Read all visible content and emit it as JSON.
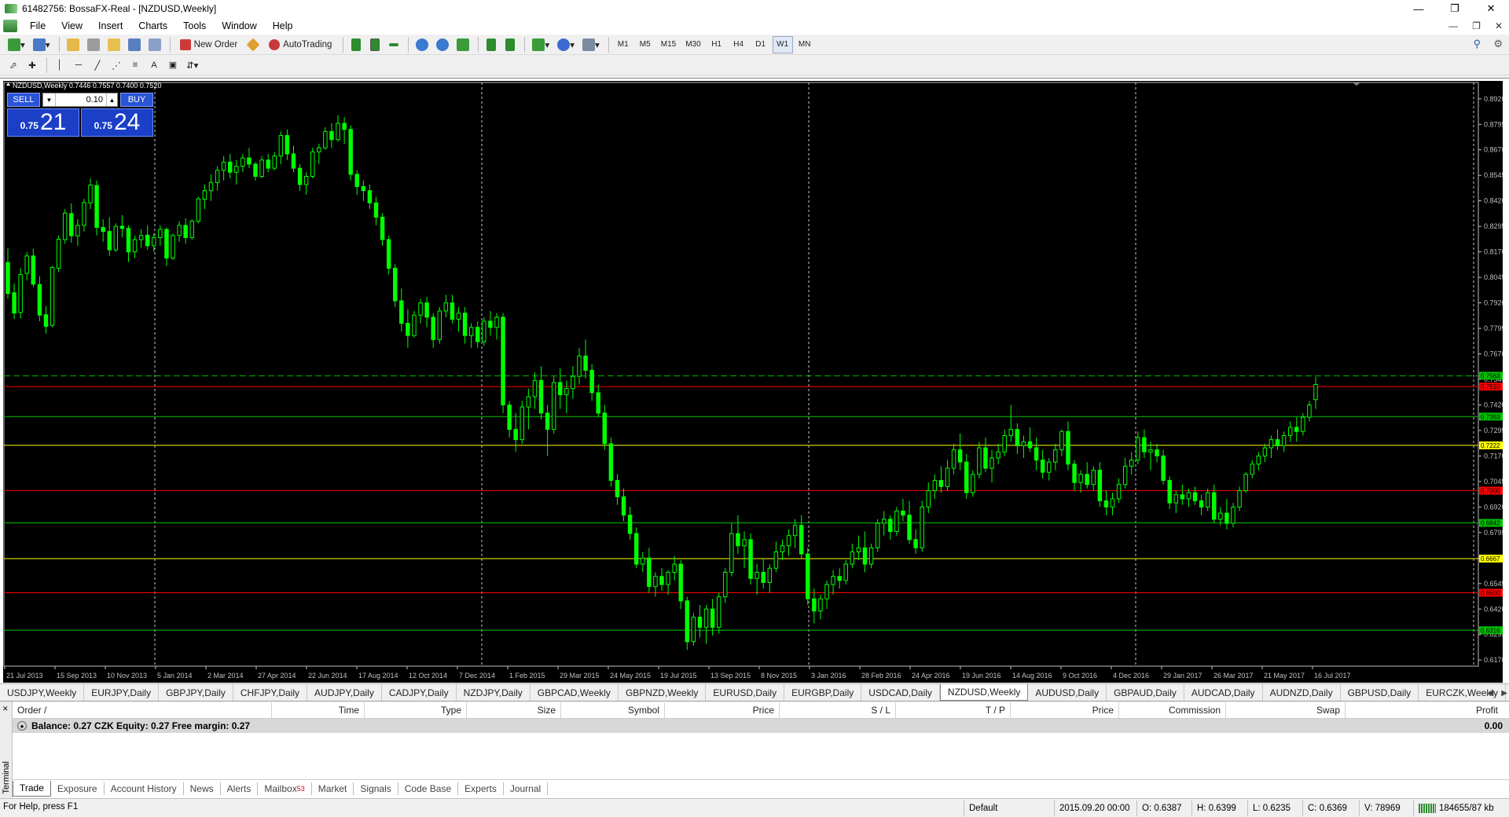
{
  "window": {
    "title": "61482756: BossaFX-Real - [NZDUSD,Weekly]"
  },
  "menu": [
    "File",
    "View",
    "Insert",
    "Charts",
    "Tools",
    "Window",
    "Help"
  ],
  "toolbar": {
    "new_order": "New Order",
    "autotrading": "AutoTrading",
    "timeframes": [
      "M1",
      "M5",
      "M15",
      "M30",
      "H1",
      "H4",
      "D1",
      "W1",
      "MN"
    ],
    "active_timeframe": "W1"
  },
  "chart": {
    "header": "NZDUSD,Weekly  0.7446 0.7557 0.7400 0.7520",
    "bg_color": "#000000",
    "bull_color": "#00ff00",
    "price_axis": [
      "0.8920",
      "0.8795",
      "0.8670",
      "0.8545",
      "0.8420",
      "0.8295",
      "0.8170",
      "0.8045",
      "0.7920",
      "0.7795",
      "0.7670",
      "0.7545",
      "0.7420",
      "0.7295",
      "0.7170",
      "0.7045",
      "0.6920",
      "0.6795",
      "0.6670",
      "0.6545",
      "0.6420",
      "0.6295",
      "0.6170"
    ],
    "time_axis": [
      "21 Jul 2013",
      "15 Sep 2013",
      "10 Nov 2013",
      "5 Jan 2014",
      "2 Mar 2014",
      "27 Apr 2014",
      "22 Jun 2014",
      "17 Aug 2014",
      "12 Oct 2014",
      "7 Dec 2014",
      "1 Feb 2015",
      "29 Mar 2015",
      "24 May 2015",
      "19 Jul 2015",
      "13 Sep 2015",
      "8 Nov 2015",
      "3 Jan 2016",
      "28 Feb 2016",
      "24 Apr 2016",
      "19 Jun 2016",
      "14 Aug 2016",
      "9 Oct 2016",
      "4 Dec 2016",
      "29 Jan 2017",
      "26 Mar 2017",
      "21 May 2017",
      "16 Jul 2017"
    ],
    "levels": [
      {
        "price": 0.7563,
        "color": "#00c000",
        "dash": true,
        "label": "0.7563"
      },
      {
        "price": 0.751,
        "color": "#ff0000",
        "label": "0.7510"
      },
      {
        "price": 0.7363,
        "color": "#00c000",
        "label": "0.7363"
      },
      {
        "price": 0.7222,
        "color": "#ffff00",
        "label": "0.7222"
      },
      {
        "price": 0.7,
        "color": "#ff0000",
        "label": "0.7000"
      },
      {
        "price": 0.6842,
        "color": "#00c000",
        "label": "0.6842"
      },
      {
        "price": 0.6667,
        "color": "#ffff00",
        "label": "0.6667"
      },
      {
        "price": 0.65,
        "color": "#ff0000",
        "label": "0.6500"
      },
      {
        "price": 0.6316,
        "color": "#00c000",
        "label": "0.6316"
      }
    ],
    "ohlc": [
      [
        0.8118,
        0.8187,
        0.794,
        0.7966
      ],
      [
        0.797,
        0.8015,
        0.784,
        0.787
      ],
      [
        0.7873,
        0.8091,
        0.7845,
        0.8059
      ],
      [
        0.8065,
        0.817,
        0.803,
        0.815
      ],
      [
        0.815,
        0.8185,
        0.7997,
        0.8012
      ],
      [
        0.801,
        0.805,
        0.783,
        0.786
      ],
      [
        0.7862,
        0.7905,
        0.777,
        0.7805
      ],
      [
        0.781,
        0.81,
        0.78,
        0.8094
      ],
      [
        0.809,
        0.825,
        0.807,
        0.8232
      ],
      [
        0.823,
        0.838,
        0.821,
        0.836
      ],
      [
        0.8358,
        0.8408,
        0.8215,
        0.8249
      ],
      [
        0.8248,
        0.833,
        0.82,
        0.83
      ],
      [
        0.83,
        0.843,
        0.827,
        0.8412
      ],
      [
        0.841,
        0.853,
        0.838,
        0.8497
      ],
      [
        0.8495,
        0.852,
        0.825,
        0.829
      ],
      [
        0.829,
        0.833,
        0.822,
        0.827
      ],
      [
        0.827,
        0.834,
        0.815,
        0.818
      ],
      [
        0.818,
        0.831,
        0.817,
        0.8295
      ],
      [
        0.8296,
        0.835,
        0.824,
        0.8285
      ],
      [
        0.8285,
        0.83,
        0.812,
        0.817
      ],
      [
        0.817,
        0.825,
        0.814,
        0.823
      ],
      [
        0.823,
        0.828,
        0.819,
        0.825
      ],
      [
        0.8252,
        0.83,
        0.818,
        0.82
      ],
      [
        0.82,
        0.826,
        0.817,
        0.824
      ],
      [
        0.824,
        0.83,
        0.82,
        0.828
      ],
      [
        0.828,
        0.829,
        0.81,
        0.814
      ],
      [
        0.814,
        0.826,
        0.813,
        0.825
      ],
      [
        0.825,
        0.832,
        0.822,
        0.83
      ],
      [
        0.83,
        0.8335,
        0.821,
        0.824
      ],
      [
        0.824,
        0.833,
        0.823,
        0.832
      ],
      [
        0.832,
        0.844,
        0.831,
        0.843
      ],
      [
        0.8428,
        0.85,
        0.838,
        0.847
      ],
      [
        0.847,
        0.855,
        0.842,
        0.851
      ],
      [
        0.851,
        0.859,
        0.847,
        0.857
      ],
      [
        0.857,
        0.864,
        0.852,
        0.861
      ],
      [
        0.861,
        0.865,
        0.853,
        0.856
      ],
      [
        0.856,
        0.862,
        0.85,
        0.859
      ],
      [
        0.859,
        0.865,
        0.856,
        0.863
      ],
      [
        0.863,
        0.868,
        0.858,
        0.86
      ],
      [
        0.86,
        0.861,
        0.852,
        0.854
      ],
      [
        0.854,
        0.864,
        0.853,
        0.862
      ],
      [
        0.862,
        0.865,
        0.856,
        0.858
      ],
      [
        0.858,
        0.866,
        0.857,
        0.864
      ],
      [
        0.864,
        0.876,
        0.86,
        0.874
      ],
      [
        0.874,
        0.877,
        0.862,
        0.865
      ],
      [
        0.865,
        0.869,
        0.856,
        0.858
      ],
      [
        0.858,
        0.86,
        0.847,
        0.85
      ],
      [
        0.85,
        0.856,
        0.845,
        0.854
      ],
      [
        0.854,
        0.868,
        0.853,
        0.866
      ],
      [
        0.866,
        0.87,
        0.86,
        0.868
      ],
      [
        0.868,
        0.878,
        0.867,
        0.876
      ],
      [
        0.876,
        0.88,
        0.868,
        0.872
      ],
      [
        0.872,
        0.884,
        0.871,
        0.88
      ],
      [
        0.88,
        0.883,
        0.87,
        0.877
      ],
      [
        0.877,
        0.879,
        0.852,
        0.855
      ],
      [
        0.855,
        0.857,
        0.845,
        0.849
      ],
      [
        0.849,
        0.852,
        0.842,
        0.847
      ],
      [
        0.847,
        0.85,
        0.838,
        0.841
      ],
      [
        0.841,
        0.844,
        0.83,
        0.834
      ],
      [
        0.834,
        0.836,
        0.82,
        0.823
      ],
      [
        0.823,
        0.825,
        0.806,
        0.809
      ],
      [
        0.809,
        0.811,
        0.79,
        0.793
      ],
      [
        0.793,
        0.799,
        0.778,
        0.782
      ],
      [
        0.782,
        0.789,
        0.77,
        0.776
      ],
      [
        0.776,
        0.788,
        0.775,
        0.786
      ],
      [
        0.786,
        0.794,
        0.782,
        0.792
      ],
      [
        0.792,
        0.795,
        0.78,
        0.785
      ],
      [
        0.785,
        0.787,
        0.77,
        0.774
      ],
      [
        0.774,
        0.79,
        0.772,
        0.788
      ],
      [
        0.788,
        0.796,
        0.785,
        0.792
      ],
      [
        0.792,
        0.796,
        0.782,
        0.784
      ],
      [
        0.784,
        0.79,
        0.778,
        0.787
      ],
      [
        0.787,
        0.79,
        0.772,
        0.776
      ],
      [
        0.776,
        0.782,
        0.77,
        0.78
      ],
      [
        0.78,
        0.783,
        0.77,
        0.773
      ],
      [
        0.773,
        0.785,
        0.771,
        0.783
      ],
      [
        0.783,
        0.788,
        0.776,
        0.78
      ],
      [
        0.78,
        0.787,
        0.774,
        0.785
      ],
      [
        0.785,
        0.787,
        0.738,
        0.742
      ],
      [
        0.742,
        0.744,
        0.726,
        0.73
      ],
      [
        0.73,
        0.738,
        0.719,
        0.725
      ],
      [
        0.725,
        0.744,
        0.723,
        0.741
      ],
      [
        0.741,
        0.75,
        0.73,
        0.746
      ],
      [
        0.746,
        0.758,
        0.74,
        0.754
      ],
      [
        0.754,
        0.761,
        0.735,
        0.738
      ],
      [
        0.738,
        0.742,
        0.717,
        0.73
      ],
      [
        0.73,
        0.756,
        0.728,
        0.753
      ],
      [
        0.753,
        0.76,
        0.74,
        0.747
      ],
      [
        0.747,
        0.754,
        0.738,
        0.75
      ],
      [
        0.75,
        0.761,
        0.745,
        0.756
      ],
      [
        0.756,
        0.77,
        0.752,
        0.766
      ],
      [
        0.766,
        0.774,
        0.755,
        0.759
      ],
      [
        0.759,
        0.762,
        0.744,
        0.748
      ],
      [
        0.748,
        0.752,
        0.736,
        0.738
      ],
      [
        0.738,
        0.742,
        0.72,
        0.723
      ],
      [
        0.723,
        0.726,
        0.702,
        0.705
      ],
      [
        0.705,
        0.708,
        0.693,
        0.697
      ],
      [
        0.697,
        0.701,
        0.685,
        0.688
      ],
      [
        0.688,
        0.692,
        0.676,
        0.679
      ],
      [
        0.679,
        0.682,
        0.662,
        0.664
      ],
      [
        0.664,
        0.67,
        0.66,
        0.667
      ],
      [
        0.667,
        0.672,
        0.65,
        0.653
      ],
      [
        0.653,
        0.66,
        0.648,
        0.658
      ],
      [
        0.658,
        0.662,
        0.651,
        0.654
      ],
      [
        0.654,
        0.661,
        0.649,
        0.66
      ],
      [
        0.66,
        0.668,
        0.656,
        0.664
      ],
      [
        0.664,
        0.666,
        0.642,
        0.646
      ],
      [
        0.646,
        0.648,
        0.622,
        0.626
      ],
      [
        0.626,
        0.64,
        0.624,
        0.638
      ],
      [
        0.638,
        0.644,
        0.628,
        0.633
      ],
      [
        0.633,
        0.644,
        0.625,
        0.642
      ],
      [
        0.642,
        0.647,
        0.629,
        0.633
      ],
      [
        0.633,
        0.65,
        0.63,
        0.648
      ],
      [
        0.648,
        0.662,
        0.645,
        0.66
      ],
      [
        0.66,
        0.684,
        0.658,
        0.679
      ],
      [
        0.679,
        0.688,
        0.669,
        0.673
      ],
      [
        0.673,
        0.68,
        0.662,
        0.676
      ],
      [
        0.676,
        0.679,
        0.654,
        0.657
      ],
      [
        0.657,
        0.664,
        0.649,
        0.66
      ],
      [
        0.66,
        0.667,
        0.652,
        0.655
      ],
      [
        0.655,
        0.664,
        0.65,
        0.662
      ],
      [
        0.662,
        0.675,
        0.66,
        0.67
      ],
      [
        0.67,
        0.676,
        0.666,
        0.673
      ],
      [
        0.673,
        0.681,
        0.668,
        0.678
      ],
      [
        0.678,
        0.686,
        0.672,
        0.683
      ],
      [
        0.683,
        0.688,
        0.667,
        0.669
      ],
      [
        0.669,
        0.672,
        0.644,
        0.647
      ],
      [
        0.647,
        0.652,
        0.635,
        0.641
      ],
      [
        0.641,
        0.649,
        0.637,
        0.647
      ],
      [
        0.647,
        0.656,
        0.642,
        0.654
      ],
      [
        0.654,
        0.661,
        0.649,
        0.658
      ],
      [
        0.658,
        0.662,
        0.652,
        0.656
      ],
      [
        0.656,
        0.666,
        0.654,
        0.664
      ],
      [
        0.664,
        0.674,
        0.662,
        0.67
      ],
      [
        0.67,
        0.678,
        0.666,
        0.672
      ],
      [
        0.672,
        0.68,
        0.66,
        0.664
      ],
      [
        0.664,
        0.674,
        0.662,
        0.672
      ],
      [
        0.672,
        0.686,
        0.67,
        0.684
      ],
      [
        0.684,
        0.69,
        0.678,
        0.686
      ],
      [
        0.686,
        0.688,
        0.676,
        0.68
      ],
      [
        0.68,
        0.692,
        0.678,
        0.69
      ],
      [
        0.69,
        0.696,
        0.685,
        0.688
      ],
      [
        0.688,
        0.695,
        0.674,
        0.676
      ],
      [
        0.676,
        0.681,
        0.669,
        0.672
      ],
      [
        0.672,
        0.695,
        0.67,
        0.692
      ],
      [
        0.692,
        0.704,
        0.689,
        0.7
      ],
      [
        0.7,
        0.708,
        0.696,
        0.705
      ],
      [
        0.705,
        0.712,
        0.699,
        0.702
      ],
      [
        0.702,
        0.715,
        0.7,
        0.711
      ],
      [
        0.711,
        0.723,
        0.708,
        0.72
      ],
      [
        0.72,
        0.728,
        0.71,
        0.714
      ],
      [
        0.714,
        0.718,
        0.696,
        0.699
      ],
      [
        0.699,
        0.71,
        0.697,
        0.708
      ],
      [
        0.708,
        0.724,
        0.706,
        0.721
      ],
      [
        0.721,
        0.726,
        0.709,
        0.711
      ],
      [
        0.711,
        0.72,
        0.704,
        0.716
      ],
      [
        0.716,
        0.723,
        0.713,
        0.719
      ],
      [
        0.719,
        0.73,
        0.717,
        0.727
      ],
      [
        0.727,
        0.742,
        0.724,
        0.73
      ],
      [
        0.73,
        0.733,
        0.718,
        0.722
      ],
      [
        0.722,
        0.727,
        0.716,
        0.724
      ],
      [
        0.724,
        0.731,
        0.719,
        0.721
      ],
      [
        0.721,
        0.726,
        0.71,
        0.715
      ],
      [
        0.715,
        0.72,
        0.706,
        0.709
      ],
      [
        0.709,
        0.716,
        0.705,
        0.714
      ],
      [
        0.714,
        0.723,
        0.71,
        0.72
      ],
      [
        0.72,
        0.73,
        0.717,
        0.729
      ],
      [
        0.729,
        0.734,
        0.71,
        0.713
      ],
      [
        0.713,
        0.715,
        0.7,
        0.704
      ],
      [
        0.704,
        0.71,
        0.699,
        0.708
      ],
      [
        0.708,
        0.714,
        0.701,
        0.703
      ],
      [
        0.703,
        0.712,
        0.7,
        0.71
      ],
      [
        0.71,
        0.714,
        0.692,
        0.695
      ],
      [
        0.695,
        0.7,
        0.688,
        0.692
      ],
      [
        0.692,
        0.699,
        0.688,
        0.696
      ],
      [
        0.696,
        0.706,
        0.694,
        0.703
      ],
      [
        0.703,
        0.716,
        0.701,
        0.712
      ],
      [
        0.712,
        0.719,
        0.708,
        0.715
      ],
      [
        0.715,
        0.729,
        0.713,
        0.726
      ],
      [
        0.726,
        0.73,
        0.716,
        0.719
      ],
      [
        0.719,
        0.724,
        0.71,
        0.72
      ],
      [
        0.72,
        0.723,
        0.714,
        0.717
      ],
      [
        0.717,
        0.72,
        0.703,
        0.705
      ],
      [
        0.705,
        0.707,
        0.691,
        0.694
      ],
      [
        0.694,
        0.7,
        0.689,
        0.698
      ],
      [
        0.698,
        0.703,
        0.693,
        0.696
      ],
      [
        0.696,
        0.701,
        0.692,
        0.699
      ],
      [
        0.699,
        0.702,
        0.693,
        0.695
      ],
      [
        0.695,
        0.698,
        0.688,
        0.692
      ],
      [
        0.692,
        0.701,
        0.69,
        0.699
      ],
      [
        0.699,
        0.703,
        0.684,
        0.686
      ],
      [
        0.686,
        0.692,
        0.683,
        0.689
      ],
      [
        0.689,
        0.696,
        0.681,
        0.684
      ],
      [
        0.684,
        0.694,
        0.682,
        0.692
      ],
      [
        0.692,
        0.702,
        0.69,
        0.7
      ],
      [
        0.7,
        0.709,
        0.699,
        0.708
      ],
      [
        0.708,
        0.715,
        0.706,
        0.713
      ],
      [
        0.713,
        0.719,
        0.71,
        0.717
      ],
      [
        0.717,
        0.723,
        0.714,
        0.721
      ],
      [
        0.721,
        0.727,
        0.716,
        0.725
      ],
      [
        0.725,
        0.73,
        0.72,
        0.722
      ],
      [
        0.722,
        0.729,
        0.719,
        0.727
      ],
      [
        0.727,
        0.734,
        0.724,
        0.731
      ],
      [
        0.731,
        0.736,
        0.724,
        0.729
      ],
      [
        0.729,
        0.738,
        0.727,
        0.736
      ],
      [
        0.736,
        0.744,
        0.734,
        0.742
      ],
      [
        0.7446,
        0.7557,
        0.74,
        0.752
      ]
    ],
    "price_max": 0.9,
    "price_min": 0.614
  },
  "oneclick": {
    "sell": "SELL",
    "buy": "BUY",
    "lot": "0.10",
    "sell_small": "0.75",
    "sell_big": "21",
    "buy_small": "0.75",
    "buy_big": "24"
  },
  "chart_tabs": [
    "USDJPY,Weekly",
    "EURJPY,Daily",
    "GBPJPY,Daily",
    "CHFJPY,Daily",
    "AUDJPY,Daily",
    "CADJPY,Daily",
    "NZDJPY,Daily",
    "GBPCAD,Weekly",
    "GBPNZD,Weekly",
    "EURUSD,Daily",
    "EURGBP,Daily",
    "USDCAD,Daily",
    "NZDUSD,Weekly",
    "AUDUSD,Daily",
    "GBPAUD,Daily",
    "AUDCAD,Daily",
    "AUDNZD,Daily",
    "GBPUSD,Daily",
    "EURCZK,Weekly"
  ],
  "active_chart_tab": "NZDUSD,Weekly",
  "terminal": {
    "side_label": "Terminal",
    "columns": [
      "Order",
      "Time",
      "Type",
      "Size",
      "Symbol",
      "Price",
      "S / L",
      "T / P",
      "Price",
      "Commission",
      "Swap",
      "Profit"
    ],
    "balance_text": "Balance: 0.27 CZK  Equity: 0.27  Free margin: 0.27",
    "profit": "0.00",
    "tabs": [
      "Trade",
      "Exposure",
      "Account History",
      "News",
      "Alerts",
      "Mailbox",
      "Market",
      "Signals",
      "Code Base",
      "Experts",
      "Journal"
    ],
    "mailbox_count": "53"
  },
  "status": {
    "help": "For Help, press F1",
    "profile": "Default",
    "datetime": "2015.09.20 00:00",
    "open": "O: 0.6387",
    "high": "H: 0.6399",
    "low": "L: 0.6235",
    "close": "C: 0.6369",
    "volume": "V: 78969",
    "traffic": "184655/87 kb"
  }
}
